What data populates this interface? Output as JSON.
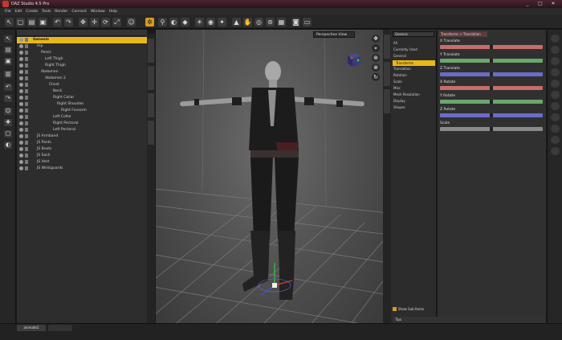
{
  "window": {
    "title": "DAZ Studio 4.5 Pro",
    "controls": [
      "_",
      "□",
      "✕"
    ]
  },
  "menu": [
    "File",
    "Edit",
    "Create",
    "Tools",
    "Render",
    "Connect",
    "Window",
    "Help"
  ],
  "scene": {
    "items": [
      {
        "label": "Genesis",
        "indent": 0,
        "selected": true
      },
      {
        "label": "Hip",
        "indent": 1
      },
      {
        "label": "Pelvis",
        "indent": 2
      },
      {
        "label": "Left Thigh",
        "indent": 3
      },
      {
        "label": "Right Thigh",
        "indent": 3
      },
      {
        "label": "Abdomen",
        "indent": 2
      },
      {
        "label": "Abdomen 2",
        "indent": 3
      },
      {
        "label": "Chest",
        "indent": 4
      },
      {
        "label": "Neck",
        "indent": 5
      },
      {
        "label": "Right Collar",
        "indent": 5
      },
      {
        "label": "Right Shoulder",
        "indent": 6
      },
      {
        "label": "Right Forearm",
        "indent": 7
      },
      {
        "label": "Left Collar",
        "indent": 5
      },
      {
        "label": "Right Pectoral",
        "indent": 5
      },
      {
        "label": "Left Pectoral",
        "indent": 5
      },
      {
        "label": "JS Armband",
        "indent": 1
      },
      {
        "label": "JS Pants",
        "indent": 1
      },
      {
        "label": "JS Boots",
        "indent": 1
      },
      {
        "label": "JS Sash",
        "indent": 1
      },
      {
        "label": "JS Vest",
        "indent": 1
      },
      {
        "label": "JS Wristguards",
        "indent": 1
      }
    ]
  },
  "viewport": {
    "view_label": "Perspective View"
  },
  "params": {
    "dropdown": "Genesis",
    "items": [
      {
        "label": "All"
      },
      {
        "label": "Currently Used"
      },
      {
        "label": "General"
      },
      {
        "label": "Transforms",
        "highlighted": true
      },
      {
        "label": "Translation"
      },
      {
        "label": "Rotation"
      },
      {
        "label": "Scale"
      },
      {
        "label": "Misc"
      },
      {
        "label": "Mesh Resolution"
      },
      {
        "label": "Display"
      },
      {
        "label": "Shapes"
      }
    ],
    "show_sub_items": "Show Sub Items",
    "tips": "Tips"
  },
  "sliders": {
    "header": "Transforms > Translation",
    "items": [
      {
        "label": "X Translate",
        "color": "#c86c6c"
      },
      {
        "label": "Y Translate",
        "color": "#6ca66c"
      },
      {
        "label": "Z Translate",
        "color": "#6c6cc8"
      },
      {
        "label": "X Rotate",
        "color": "#c86c6c"
      },
      {
        "label": "Y Rotate",
        "color": "#6ca66c"
      },
      {
        "label": "Z Rotate",
        "color": "#6c6cc8"
      },
      {
        "label": "Scale",
        "color": "#8a8a8a"
      }
    ]
  },
  "bottom": {
    "tab_active": "animate2"
  },
  "accent": "#e8b81a"
}
